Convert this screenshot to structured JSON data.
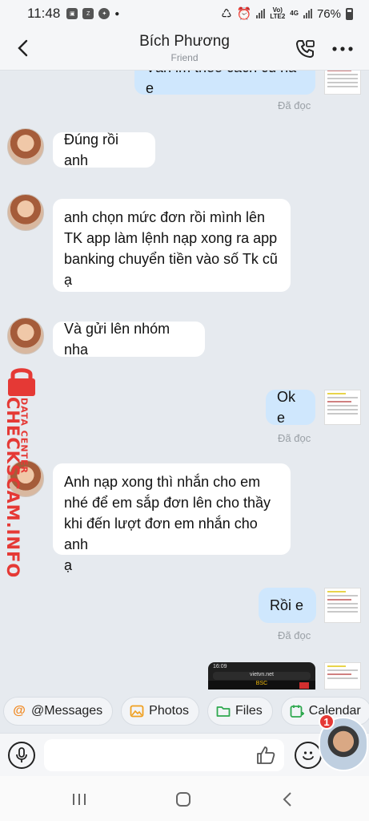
{
  "status_bar": {
    "time": "11:48",
    "battery": "76%",
    "net_top": "Vo)",
    "net_bottom": "LTE2",
    "net2": "4G"
  },
  "header": {
    "title": "Bích Phương",
    "subtitle": "Friend"
  },
  "messages": [
    {
      "text": "Vẫn lm theo cách củ hả e",
      "seen": "Đã đọc"
    },
    {
      "text": "Đúng rồi anh"
    },
    {
      "text": "anh chọn mức đơn rồi mình lên\nTK app làm lệnh nạp xong ra app\nbanking chuyển tiền vào số Tk cũ\nạ"
    },
    {
      "text": "Và gửi lên nhóm nha"
    },
    {
      "text": "Ok e",
      "seen": "Đã đọc"
    },
    {
      "text": "Anh nạp xong thì nhắn cho em\nnhé để em sắp đơn lên cho thầy\nkhi đến lượt đơn em nhắn cho anh\nạ"
    },
    {
      "text": "Rồi e",
      "seen": "Đã đọc"
    }
  ],
  "screenshot_preview": {
    "time": "16:09",
    "url": "vietvn.net",
    "label": "BSC"
  },
  "watermark": {
    "big": "CHECKSCAM.INFO",
    "small": "DATA CENTER"
  },
  "quick_actions": [
    {
      "label": "@Messages",
      "icon": "at-icon",
      "color": "#f08a24"
    },
    {
      "label": "Photos",
      "icon": "photo-icon",
      "color": "#f0a020"
    },
    {
      "label": "Files",
      "icon": "folder-icon",
      "color": "#2fa84f"
    },
    {
      "label": "Calendar",
      "icon": "calendar-icon",
      "color": "#2fa84f"
    }
  ],
  "input": {
    "placeholder": ""
  },
  "chat_head_badge": "1",
  "colors": {
    "outgoing": "#cfe7fd",
    "incoming": "#ffffff",
    "background": "#e6eaef",
    "watermark": "#e53935"
  }
}
